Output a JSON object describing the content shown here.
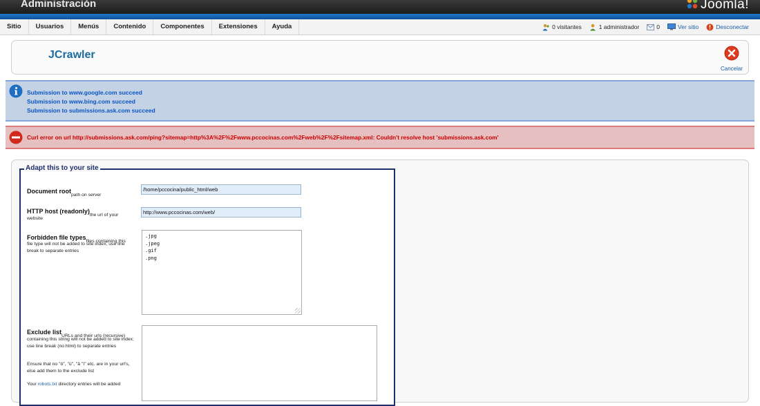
{
  "header": {
    "admin_title": "Administración",
    "brand": "Joomla!"
  },
  "menu": [
    {
      "label": "Sitio"
    },
    {
      "label": "Usuarios"
    },
    {
      "label": "Menús"
    },
    {
      "label": "Contenido"
    },
    {
      "label": "Componentes"
    },
    {
      "label": "Extensiones"
    },
    {
      "label": "Ayuda"
    }
  ],
  "status": {
    "visitors": "0 visitantes",
    "admins": "1 administrador",
    "messages": "0",
    "view_site": "Ver sitio",
    "logout": "Desconectar"
  },
  "toolbar": {
    "title": "JCrawler",
    "cancel_label": "Cancelar"
  },
  "messages": {
    "info": [
      "Submission to www.google.com succeed",
      "Submission to www.bing.com succeed",
      "Submission to submissions.ask.com succeed"
    ],
    "error": "Curl error on url http://submissions.ask.com/ping?sitemap=http%3A%2F%2Fwww.pccocinas.com%2Fweb%2F%2Fsitemap.xml: Couldn't resolve host 'submissions.ask.com'"
  },
  "form": {
    "legend": "Adapt this to your site",
    "document_root": {
      "label": "Document root",
      "desc": "path on server",
      "value": "/home/pccocina/public_html/web"
    },
    "http_host": {
      "label": "HTTP host (readonly)",
      "desc_a": "the url of your",
      "desc_b": "website",
      "value": "http://www.pccocinas.com/web/"
    },
    "forbidden": {
      "label": "Forbidden file types",
      "desc_a": "files containing this",
      "desc_b": "file type will not be added to site index; use line break to separate entries",
      "value": ".jpg\n.jpeg\n.gif\n.png"
    },
    "exclude": {
      "label": "Exclude list",
      "desc_a": "URLs and their urls (recursive)",
      "desc_b": "containing this string will not be added to site index; use line break (no html) to separate entries",
      "desc_c": "Ensure that no \"ò\", \"ü\", \"ä \"ì\" etc. are in your url's, else add them to the exclude list",
      "desc_d_pre": "Your",
      "desc_d_link": "robots.txt",
      "desc_d_post": "directory entries will be added",
      "value": ""
    }
  },
  "colors": {
    "header_blue": "#1f78c9",
    "title_blue": "#1a6aa0",
    "info_bg": "#c3d2e5",
    "info_text": "#0b55c4",
    "error_bg": "#e6c0c0",
    "error_text": "#cc0000",
    "fieldset_border": "#1e2f6e"
  },
  "icons": [
    "joomla-logo-icon",
    "visitors-icon",
    "admin-icon",
    "messages-icon",
    "view-site-icon",
    "logout-icon",
    "cancel-icon",
    "info-icon",
    "error-icon"
  ]
}
